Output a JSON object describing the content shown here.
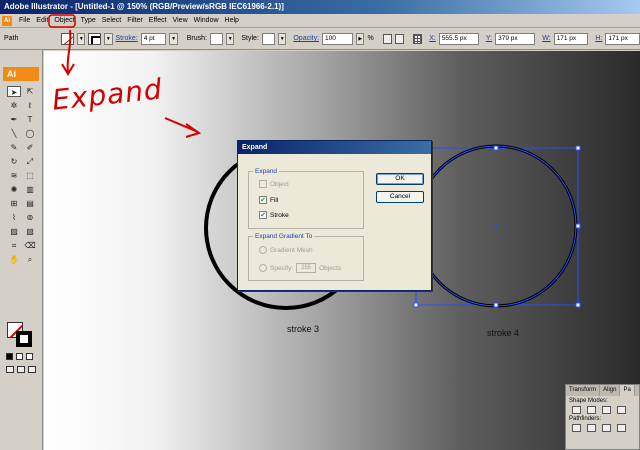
{
  "window": {
    "title": "Adobe Illustrator - [Untitled-1 @ 150% (RGB/Preview/sRGB IEC61966-2.1)]"
  },
  "menubar": {
    "app_icon": "Ai",
    "items": [
      "File",
      "Edit",
      "Object",
      "Type",
      "Select",
      "Filter",
      "Effect",
      "View",
      "Window",
      "Help"
    ]
  },
  "control_bar": {
    "selection_label": "Path",
    "stroke_label": "Stroke:",
    "stroke_weight": "4 pt",
    "brush_label": "Brush:",
    "style_label": "Style:",
    "opacity_label": "Opacity:",
    "opacity_value": "100",
    "opacity_unit": "%",
    "x_label": "X:",
    "x_value": "555.5 px",
    "y_label": "Y:",
    "y_value": "379 px",
    "w_label": "W:",
    "w_value": "171 px",
    "h_label": "H:",
    "h_value": "171 px"
  },
  "toolbox": {
    "badge": "Ai"
  },
  "annotation": {
    "text": "Expand",
    "color": "#d40000"
  },
  "canvas": {
    "captions": {
      "left": "stroke 3",
      "right": "stroke 4"
    }
  },
  "expand_dialog": {
    "title": "Expand",
    "expand_group": {
      "legend": "Expand",
      "object_label": "Object",
      "fill_label": "Fill",
      "stroke_label": "Stroke",
      "object_checked": false,
      "fill_checked": true,
      "stroke_checked": true
    },
    "gradient_group": {
      "legend": "Expand Gradient To",
      "mesh_label": "Gradient Mesh",
      "specify_label": "Specify:",
      "specify_value": "255",
      "objects_label": "Objects"
    },
    "ok_label": "OK",
    "cancel_label": "Cancel"
  },
  "pathfinder_panel": {
    "tabs": [
      "Transform",
      "Align",
      "Pa"
    ],
    "shape_modes_label": "Shape Modes:",
    "pathfinders_label": "Pathfinders:"
  },
  "colors": {
    "accent": "#f28b16",
    "annotation_red": "#d40000",
    "selection_blue": "#2a4cff",
    "title_bar": "#0a246a"
  }
}
